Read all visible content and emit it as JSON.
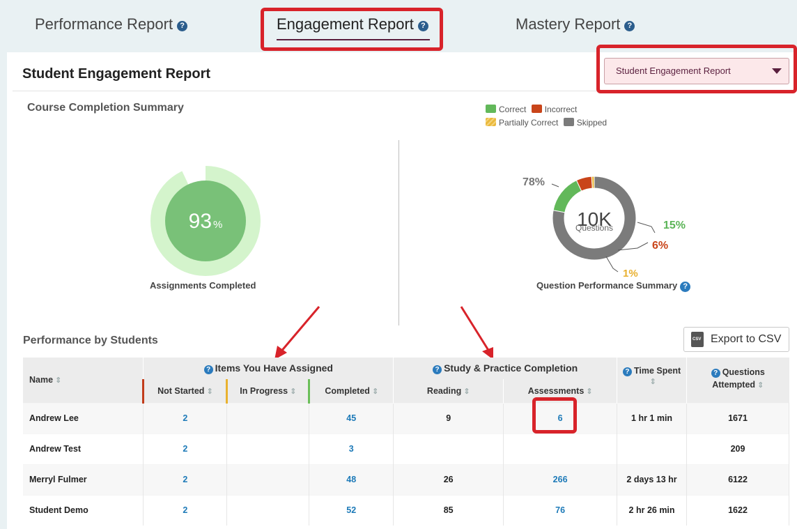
{
  "tabs": [
    {
      "label": "Performance Report"
    },
    {
      "label": "Engagement Report"
    },
    {
      "label": "Mastery Report"
    }
  ],
  "header": {
    "title": "Student Engagement Report",
    "report_select": "Student Engagement Report"
  },
  "summary": {
    "title": "Course Completion Summary",
    "completion_percent": "93",
    "percent_sign": "%",
    "completion_value": 93,
    "completion_caption": "Assignments Completed",
    "legend": [
      {
        "label": "Correct",
        "color": "#62b85a"
      },
      {
        "label": "Incorrect",
        "color": "#c9451a"
      },
      {
        "label": "Partially Correct",
        "color": "#eab93c"
      },
      {
        "label": "Skipped",
        "color": "#7b7b7b"
      }
    ],
    "question_total": "10K",
    "question_unit": "Questions",
    "question_caption": "Question Performance Summary",
    "question_breakdown": {
      "skipped": {
        "label": "78%",
        "value": 78
      },
      "correct": {
        "label": "15%",
        "value": 15
      },
      "incorrect": {
        "label": "6%",
        "value": 6
      },
      "partial": {
        "label": "1%",
        "value": 1
      }
    }
  },
  "students_section": {
    "title": "Performance by Students",
    "export_label": "Export to CSV",
    "export_icon_text": "CSV"
  },
  "table": {
    "headers": {
      "name": "Name",
      "items_assigned": "Items You Have Assigned",
      "study_practice": "Study & Practice Completion",
      "time_spent": "Time Spent",
      "questions_attempted_1": "Questions",
      "questions_attempted_2": "Attempted",
      "not_started": "Not Started",
      "in_progress": "In Progress",
      "completed": "Completed",
      "reading": "Reading",
      "assessments": "Assessments"
    },
    "rows": [
      {
        "name": "Andrew Lee",
        "not_started": "2",
        "in_progress": "",
        "completed": "45",
        "reading": "9",
        "assessments": "6",
        "time_spent": "1 hr 1 min",
        "questions": "1671"
      },
      {
        "name": "Andrew Test",
        "not_started": "2",
        "in_progress": "",
        "completed": "3",
        "reading": "",
        "assessments": "",
        "time_spent": "",
        "questions": "209"
      },
      {
        "name": "Merryl Fulmer",
        "not_started": "2",
        "in_progress": "",
        "completed": "48",
        "reading": "26",
        "assessments": "266",
        "time_spent": "2 days 13 hr",
        "questions": "6122"
      },
      {
        "name": "Student Demo",
        "not_started": "2",
        "in_progress": "",
        "completed": "52",
        "reading": "85",
        "assessments": "76",
        "time_spent": "2 hr 26 min",
        "questions": "1622"
      }
    ]
  }
}
